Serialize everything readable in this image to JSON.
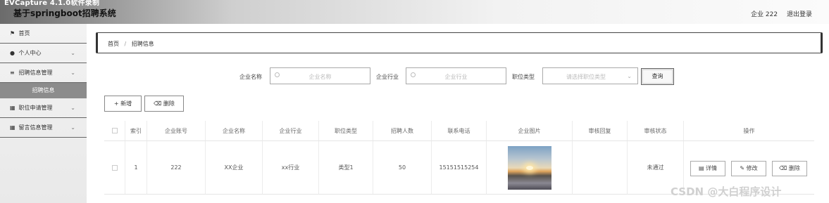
{
  "window": {
    "capture_label": "EVCapture 4.1.0软件录制"
  },
  "header": {
    "title": "基于springboot招聘系统",
    "user": "企业 222",
    "logout": "退出登录"
  },
  "sidebar": {
    "items": [
      {
        "label": "首页",
        "icon": "home-icon"
      },
      {
        "label": "个人中心",
        "icon": "user-icon"
      },
      {
        "label": "招聘信息管理",
        "icon": "list-icon"
      },
      {
        "label": "职位申请管理",
        "icon": "grid-icon"
      },
      {
        "label": "留言信息管理",
        "icon": "grid-icon"
      }
    ],
    "active_sub": "招聘信息"
  },
  "breadcrumb": {
    "home": "首页",
    "separator": "/",
    "current": "招聘信息"
  },
  "search": {
    "company_name_label": "企业名称",
    "company_name_placeholder": "企业名称",
    "industry_label": "企业行业",
    "industry_placeholder": "企业行业",
    "position_type_label": "职位类型",
    "position_type_placeholder": "请选择职位类型",
    "query_button": "查询"
  },
  "toolbar": {
    "add": "+ 新增",
    "delete": "删除"
  },
  "table": {
    "headers": [
      "",
      "索引",
      "企业账号",
      "企业名称",
      "企业行业",
      "职位类型",
      "招聘人数",
      "联系电话",
      "企业图片",
      "审核回复",
      "审核状态",
      "操作"
    ],
    "rows": [
      {
        "index": "1",
        "account": "222",
        "company": "XX企业",
        "industry": "xx行业",
        "type": "类型1",
        "count": "50",
        "phone": "15151515254",
        "reply": "",
        "status": "未通过",
        "detail": "详情",
        "edit": "修改",
        "remove": "删除"
      }
    ]
  },
  "watermark": "CSDN @大白程序设计"
}
